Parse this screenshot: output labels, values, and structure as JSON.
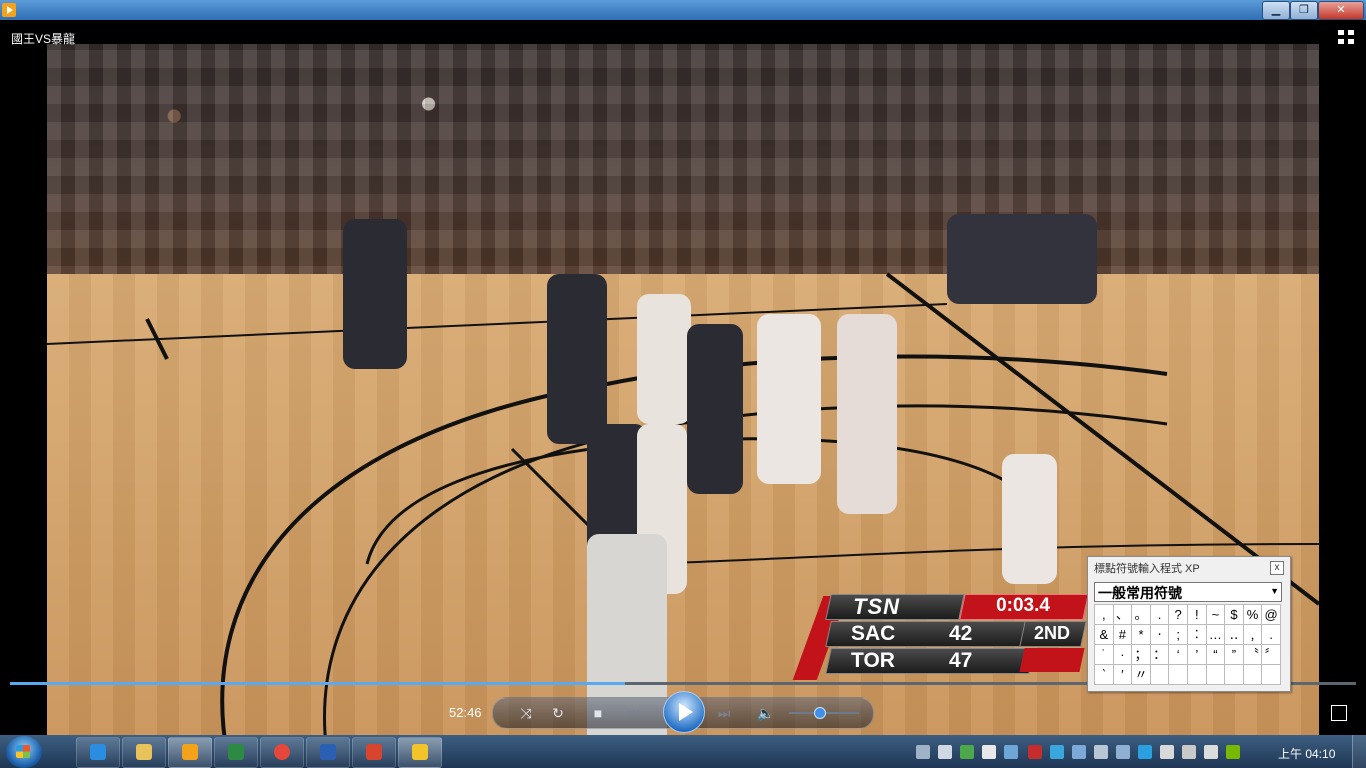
{
  "window": {
    "title_bar": "",
    "minimize": "▁",
    "maximize": "❐",
    "close": "✕"
  },
  "player": {
    "video_title": "國王VS暴龍",
    "elapsed_time": "52:46",
    "progress_fraction": 0.457,
    "volume_fraction": 0.43
  },
  "scoreboard": {
    "network": "TSN",
    "clock": "0:03.4",
    "period": "2ND",
    "teams": [
      {
        "abbr": "SAC",
        "score": "42"
      },
      {
        "abbr": "TOR",
        "score": "47"
      }
    ],
    "accent_red": "#c3131a"
  },
  "ime": {
    "title": "標點符號輸入程式 XP",
    "close": "x",
    "category": "一般常用符號",
    "symbols": [
      ",",
      "、",
      "。",
      ".",
      "?",
      "!",
      "~",
      "$",
      "%",
      "@",
      "&",
      "#",
      "*",
      "‧",
      ";",
      "︰",
      "…",
      "‥",
      "﹐",
      "﹒",
      "˙",
      "·",
      "；",
      "：",
      "‘",
      "’",
      "“",
      "”",
      "〝",
      "〞",
      "‵",
      "′",
      "〃"
    ]
  },
  "taskbar": {
    "clock": "上午 04:10",
    "apps": [
      "internet-explorer-icon",
      "explorer-folder-icon",
      "media-player-icon",
      "excel-icon",
      "chrome-icon",
      "word-icon",
      "pdf-icon",
      "norton-icon"
    ]
  }
}
